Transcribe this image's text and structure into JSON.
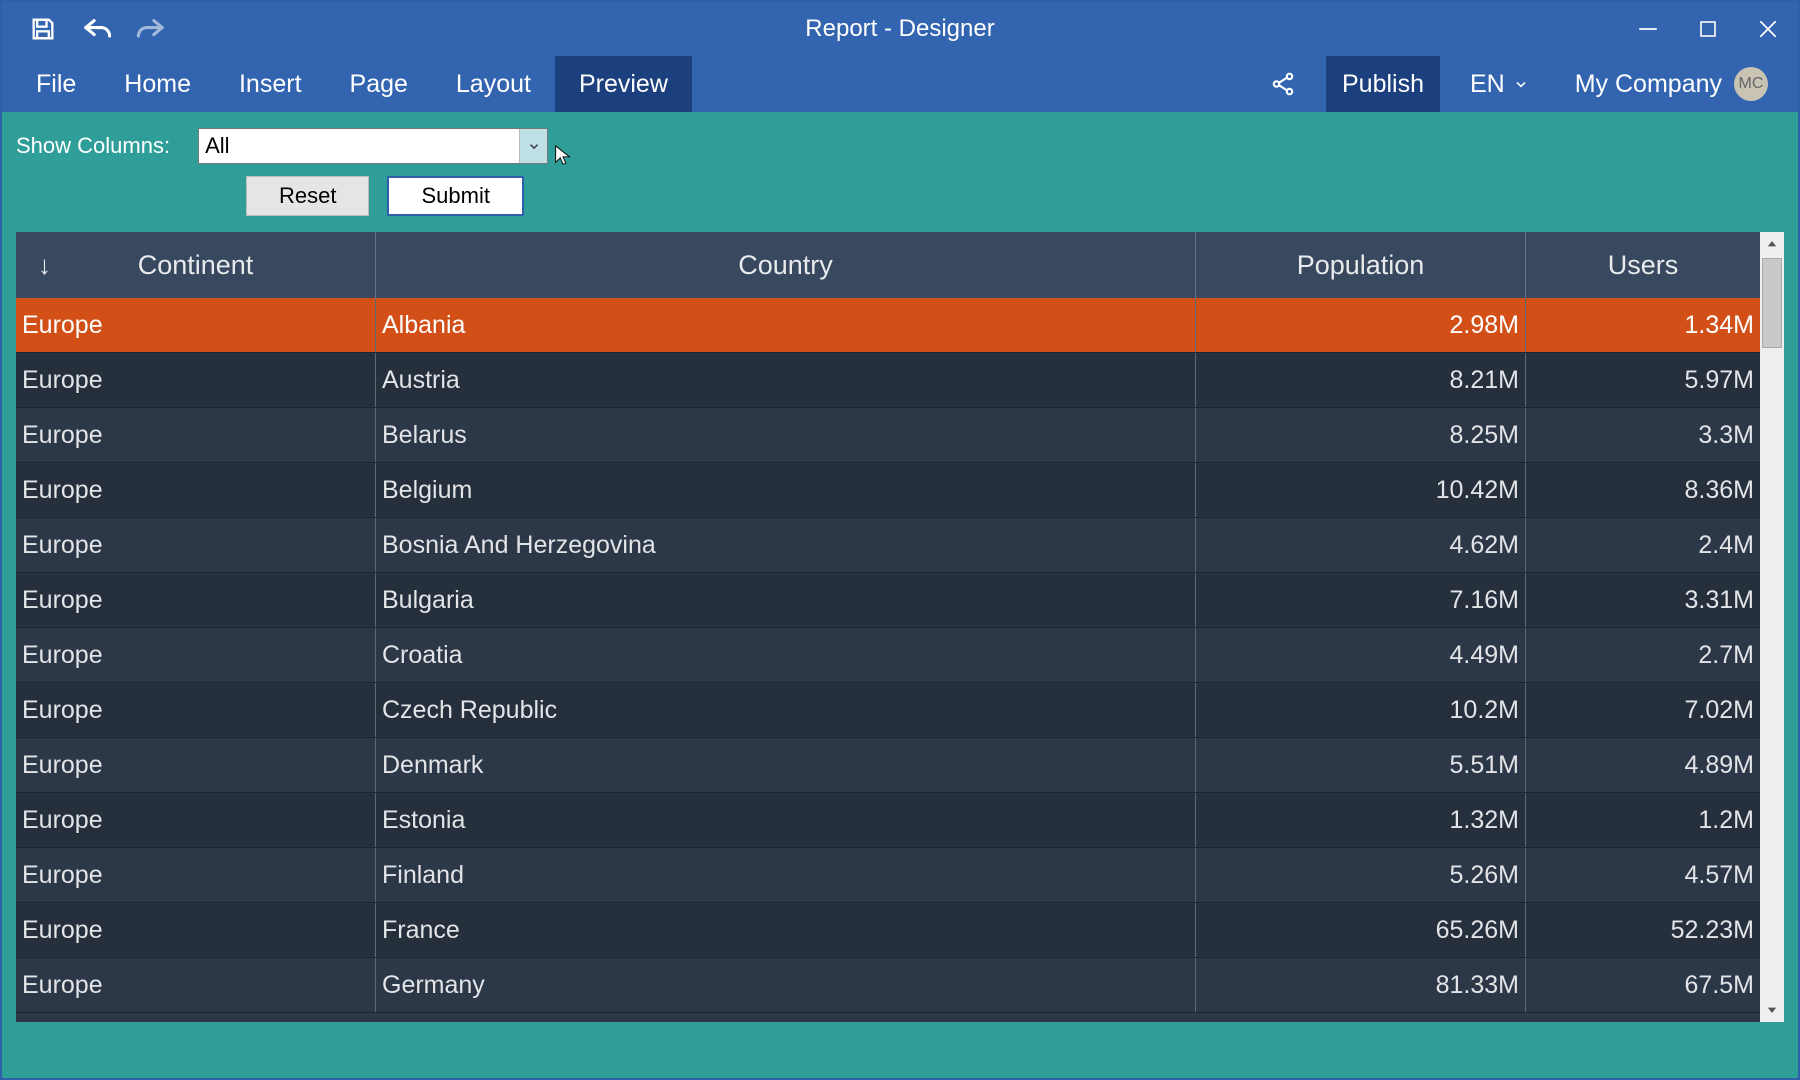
{
  "window": {
    "title": "Report - Designer"
  },
  "quick_access": {
    "save": "save",
    "undo": "undo",
    "redo": "redo"
  },
  "ribbon": {
    "tabs": [
      "File",
      "Home",
      "Insert",
      "Page",
      "Layout",
      "Preview"
    ],
    "active_index": 5,
    "share": "share",
    "publish_label": "Publish",
    "language_label": "EN",
    "account_label": "My Company",
    "avatar_initials": "MC"
  },
  "toolbar": {
    "show_columns_label": "Show Columns:",
    "combo_value": "All",
    "reset_label": "Reset",
    "submit_label": "Submit"
  },
  "table": {
    "headers": {
      "continent": "Continent",
      "country": "Country",
      "population": "Population",
      "users": "Users",
      "sort_arrow": "↓"
    },
    "selected_index": 0,
    "rows": [
      {
        "continent": "Europe",
        "country": "Albania",
        "population": "2.98M",
        "users": "1.34M"
      },
      {
        "continent": "Europe",
        "country": "Austria",
        "population": "8.21M",
        "users": "5.97M"
      },
      {
        "continent": "Europe",
        "country": "Belarus",
        "population": "8.25M",
        "users": "3.3M"
      },
      {
        "continent": "Europe",
        "country": "Belgium",
        "population": "10.42M",
        "users": "8.36M"
      },
      {
        "continent": "Europe",
        "country": "Bosnia And Herzegovina",
        "population": "4.62M",
        "users": "2.4M"
      },
      {
        "continent": "Europe",
        "country": "Bulgaria",
        "population": "7.16M",
        "users": "3.31M"
      },
      {
        "continent": "Europe",
        "country": "Croatia",
        "population": "4.49M",
        "users": "2.7M"
      },
      {
        "continent": "Europe",
        "country": "Czech Republic",
        "population": "10.2M",
        "users": "7.02M"
      },
      {
        "continent": "Europe",
        "country": "Denmark",
        "population": "5.51M",
        "users": "4.89M"
      },
      {
        "continent": "Europe",
        "country": "Estonia",
        "population": "1.32M",
        "users": "1.2M"
      },
      {
        "continent": "Europe",
        "country": "Finland",
        "population": "5.26M",
        "users": "4.57M"
      },
      {
        "continent": "Europe",
        "country": "France",
        "population": "65.26M",
        "users": "52.23M"
      },
      {
        "continent": "Europe",
        "country": "Germany",
        "population": "81.33M",
        "users": "67.5M"
      }
    ]
  },
  "colors": {
    "brand_blue": "#3264b0",
    "brand_blue_dark": "#1c3f7d",
    "teal_bg": "#2f9e98",
    "table_bg": "#2c3747",
    "header_bg": "#37485f",
    "selected_row": "#d25018"
  }
}
